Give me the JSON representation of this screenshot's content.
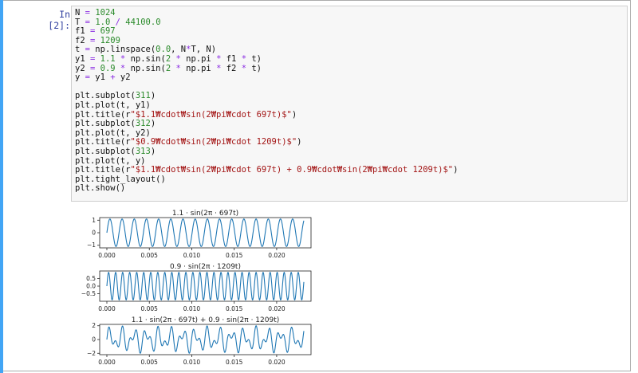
{
  "notebook": {
    "cell": {
      "prompt": "In [2]:",
      "code_lines": [
        [
          {
            "t": "N "
          },
          {
            "t": "=",
            "c": "op"
          },
          {
            "t": " "
          },
          {
            "t": "1024",
            "c": "num"
          }
        ],
        [
          {
            "t": "T "
          },
          {
            "t": "=",
            "c": "op"
          },
          {
            "t": " "
          },
          {
            "t": "1.0",
            "c": "num"
          },
          {
            "t": " "
          },
          {
            "t": "/",
            "c": "op"
          },
          {
            "t": " "
          },
          {
            "t": "44100.0",
            "c": "num"
          }
        ],
        [
          {
            "t": "f1 "
          },
          {
            "t": "=",
            "c": "op"
          },
          {
            "t": " "
          },
          {
            "t": "697",
            "c": "num"
          }
        ],
        [
          {
            "t": "f2 "
          },
          {
            "t": "=",
            "c": "op"
          },
          {
            "t": " "
          },
          {
            "t": "1209",
            "c": "num"
          }
        ],
        [
          {
            "t": "t "
          },
          {
            "t": "=",
            "c": "op"
          },
          {
            "t": " np.linspace("
          },
          {
            "t": "0.0",
            "c": "num"
          },
          {
            "t": ", N"
          },
          {
            "t": "*",
            "c": "op"
          },
          {
            "t": "T, N)"
          }
        ],
        [
          {
            "t": "y1 "
          },
          {
            "t": "=",
            "c": "op"
          },
          {
            "t": " "
          },
          {
            "t": "1.1",
            "c": "num"
          },
          {
            "t": " "
          },
          {
            "t": "*",
            "c": "op"
          },
          {
            "t": " np.sin("
          },
          {
            "t": "2",
            "c": "num"
          },
          {
            "t": " "
          },
          {
            "t": "*",
            "c": "op"
          },
          {
            "t": " np.pi "
          },
          {
            "t": "*",
            "c": "op"
          },
          {
            "t": " f1 "
          },
          {
            "t": "*",
            "c": "op"
          },
          {
            "t": " t)"
          }
        ],
        [
          {
            "t": "y2 "
          },
          {
            "t": "=",
            "c": "op"
          },
          {
            "t": " "
          },
          {
            "t": "0.9",
            "c": "num"
          },
          {
            "t": " "
          },
          {
            "t": "*",
            "c": "op"
          },
          {
            "t": " np.sin("
          },
          {
            "t": "2",
            "c": "num"
          },
          {
            "t": " "
          },
          {
            "t": "*",
            "c": "op"
          },
          {
            "t": " np.pi "
          },
          {
            "t": "*",
            "c": "op"
          },
          {
            "t": " f2 "
          },
          {
            "t": "*",
            "c": "op"
          },
          {
            "t": " t)"
          }
        ],
        [
          {
            "t": "y "
          },
          {
            "t": "=",
            "c": "op"
          },
          {
            "t": " y1 "
          },
          {
            "t": "+",
            "c": "op"
          },
          {
            "t": " y2"
          }
        ],
        [],
        [
          {
            "t": "plt.subplot("
          },
          {
            "t": "311",
            "c": "num"
          },
          {
            "t": ")"
          }
        ],
        [
          {
            "t": "plt.plot(t, y1)"
          }
        ],
        [
          {
            "t": "plt.title(r"
          },
          {
            "t": "\"$1.1₩cdot₩sin(2₩pi₩cdot 697t)$\"",
            "c": "str"
          },
          {
            "t": ")"
          }
        ],
        [
          {
            "t": "plt.subplot("
          },
          {
            "t": "312",
            "c": "num"
          },
          {
            "t": ")"
          }
        ],
        [
          {
            "t": "plt.plot(t, y2)"
          }
        ],
        [
          {
            "t": "plt.title(r"
          },
          {
            "t": "\"$0.9₩cdot₩sin(2₩pi₩cdot 1209t)$\"",
            "c": "str"
          },
          {
            "t": ")"
          }
        ],
        [
          {
            "t": "plt.subplot("
          },
          {
            "t": "313",
            "c": "num"
          },
          {
            "t": ")"
          }
        ],
        [
          {
            "t": "plt.plot(t, y)"
          }
        ],
        [
          {
            "t": "plt.title(r"
          },
          {
            "t": "\"$1.1₩cdot₩sin(2₩pi₩cdot 697t) + 0.9₩cdot₩sin(2₩pi₩cdot 1209t)$\"",
            "c": "str"
          },
          {
            "t": ")"
          }
        ],
        [
          {
            "t": "plt.tight_layout()"
          }
        ],
        [
          {
            "t": "plt.show()"
          }
        ]
      ]
    },
    "output": {
      "x_tick_labels": [
        "0.000",
        "0.005",
        "0.010",
        "0.015",
        "0.020"
      ],
      "line_color": "#1f77b4"
    }
  },
  "chart_data": [
    {
      "type": "line",
      "title": "1.1 · sin(2π · 697t)",
      "x_range": [
        0,
        0.0232
      ],
      "xticks": [
        0.0,
        0.005,
        0.01,
        0.015,
        0.02
      ],
      "ylim": [
        -1.21,
        1.21
      ],
      "yticks": [
        -1,
        0,
        1
      ],
      "ytick_labels": [
        "−1",
        "0",
        "1"
      ],
      "series": [
        {
          "components": [
            {
              "amplitude": 1.1,
              "frequency": 697
            }
          ]
        }
      ]
    },
    {
      "type": "line",
      "title": "0.9 · sin(2π · 1209t)",
      "x_range": [
        0,
        0.0232
      ],
      "xticks": [
        0.0,
        0.005,
        0.01,
        0.015,
        0.02
      ],
      "ylim": [
        -0.99,
        0.99
      ],
      "yticks": [
        -0.5,
        0.0,
        0.5
      ],
      "ytick_labels": [
        "−0.5",
        "0.0",
        "0.5"
      ],
      "series": [
        {
          "components": [
            {
              "amplitude": 0.9,
              "frequency": 1209
            }
          ]
        }
      ]
    },
    {
      "type": "line",
      "title": "1.1 · sin(2π · 697t) + 0.9 · sin(2π · 1209t)",
      "x_range": [
        0,
        0.0232
      ],
      "xticks": [
        0.0,
        0.005,
        0.01,
        0.015,
        0.02
      ],
      "ylim": [
        -2.2,
        2.2
      ],
      "yticks": [
        -2,
        0,
        2
      ],
      "ytick_labels": [
        "−2",
        "0",
        "2"
      ],
      "series": [
        {
          "components": [
            {
              "amplitude": 1.1,
              "frequency": 697
            },
            {
              "amplitude": 0.9,
              "frequency": 1209
            }
          ]
        }
      ]
    }
  ]
}
